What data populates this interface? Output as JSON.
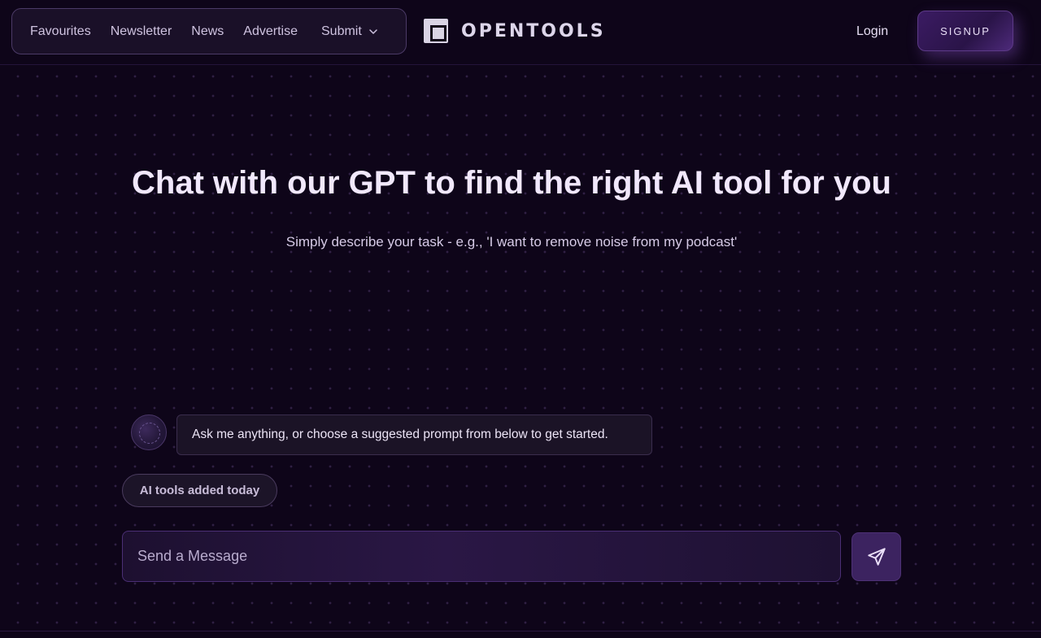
{
  "nav": {
    "links": [
      "Favourites",
      "Newsletter",
      "News",
      "Advertise"
    ],
    "submit_label": "Submit",
    "logo_text": "OPENTOOLS",
    "login_label": "Login",
    "signup_label": "SIGNUP"
  },
  "hero": {
    "title": "Chat with our GPT to find the right AI tool for you",
    "subtitle": "Simply describe your task - e.g., 'I want to remove noise from my podcast'"
  },
  "chat": {
    "bot_message": "Ask me anything, or choose a suggested prompt from below to get started.",
    "suggested_prompts": [
      "AI tools added today"
    ],
    "input_placeholder": "Send a Message",
    "input_value": ""
  },
  "colors": {
    "background": "#0e0519",
    "accent": "#3c2360",
    "text": "#f1e8fc"
  },
  "icons": {
    "submit_dropdown": "chevron-down-icon",
    "send": "send-icon",
    "logo": "logo-icon",
    "bot": "bot-avatar"
  }
}
